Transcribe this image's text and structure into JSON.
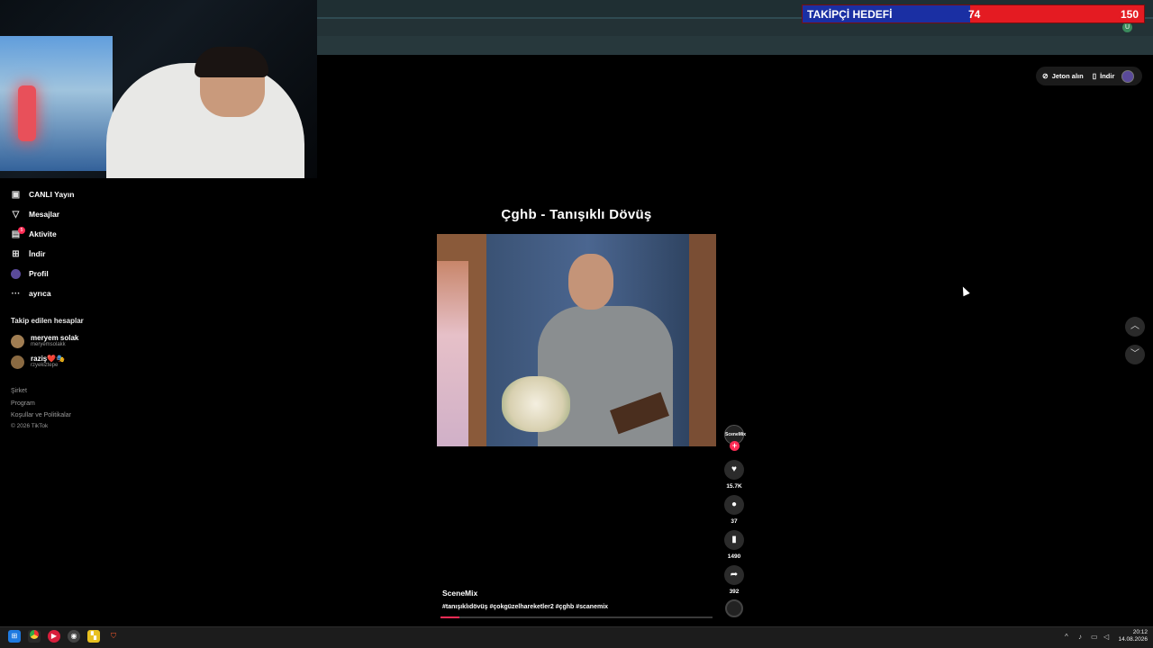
{
  "goal_overlay": {
    "title": "TAKİPÇİ HEDEFİ",
    "current": "74",
    "target": "150",
    "progress_fraction": 0.49
  },
  "sidebar": {
    "items": [
      {
        "label": "CANLI Yayın",
        "icon": "live-icon"
      },
      {
        "label": "Mesajlar",
        "icon": "messages-icon"
      },
      {
        "label": "Aktivite",
        "icon": "activity-icon",
        "badge": "5"
      },
      {
        "label": "İndir",
        "icon": "download-icon"
      },
      {
        "label": "Profil",
        "icon": "profile-icon"
      },
      {
        "label": "ayrıca",
        "icon": "more-icon"
      }
    ],
    "following_header": "Takip edilen hesaplar",
    "following": [
      {
        "name": "meryem solak",
        "handle": "meryemsolakk"
      },
      {
        "name": "raziş❤️🎭",
        "handle": "rzyekiztepe"
      }
    ],
    "footer": [
      "Şirket",
      "Program",
      "Koşullar ve Politikalar",
      "© 2026 TikTok"
    ]
  },
  "top_right": {
    "coins_label": "Jeton alın",
    "download_label": "İndir"
  },
  "video": {
    "title": "Çghb - Tanışıklı Dövüş",
    "author": "SceneMix",
    "caption": "#tanışıklıdövüş #çokgüzelhareketler2 #çghb #scanemix",
    "progress_fraction": 0.07,
    "creator_avatar_text": "SceneMix",
    "follow_plus": "+"
  },
  "actions": [
    {
      "icon": "heart-icon",
      "count": "15.7K"
    },
    {
      "icon": "comment-icon",
      "count": "37"
    },
    {
      "icon": "bookmark-icon",
      "count": "1490"
    },
    {
      "icon": "share-icon",
      "count": "392"
    }
  ],
  "taskbar": {
    "time": "20:12",
    "date": "14.08.2026"
  },
  "colors": {
    "goal_blue": "#1a2fa3",
    "goal_red": "#e41b22",
    "tiktok_pink": "#fe2c55"
  }
}
